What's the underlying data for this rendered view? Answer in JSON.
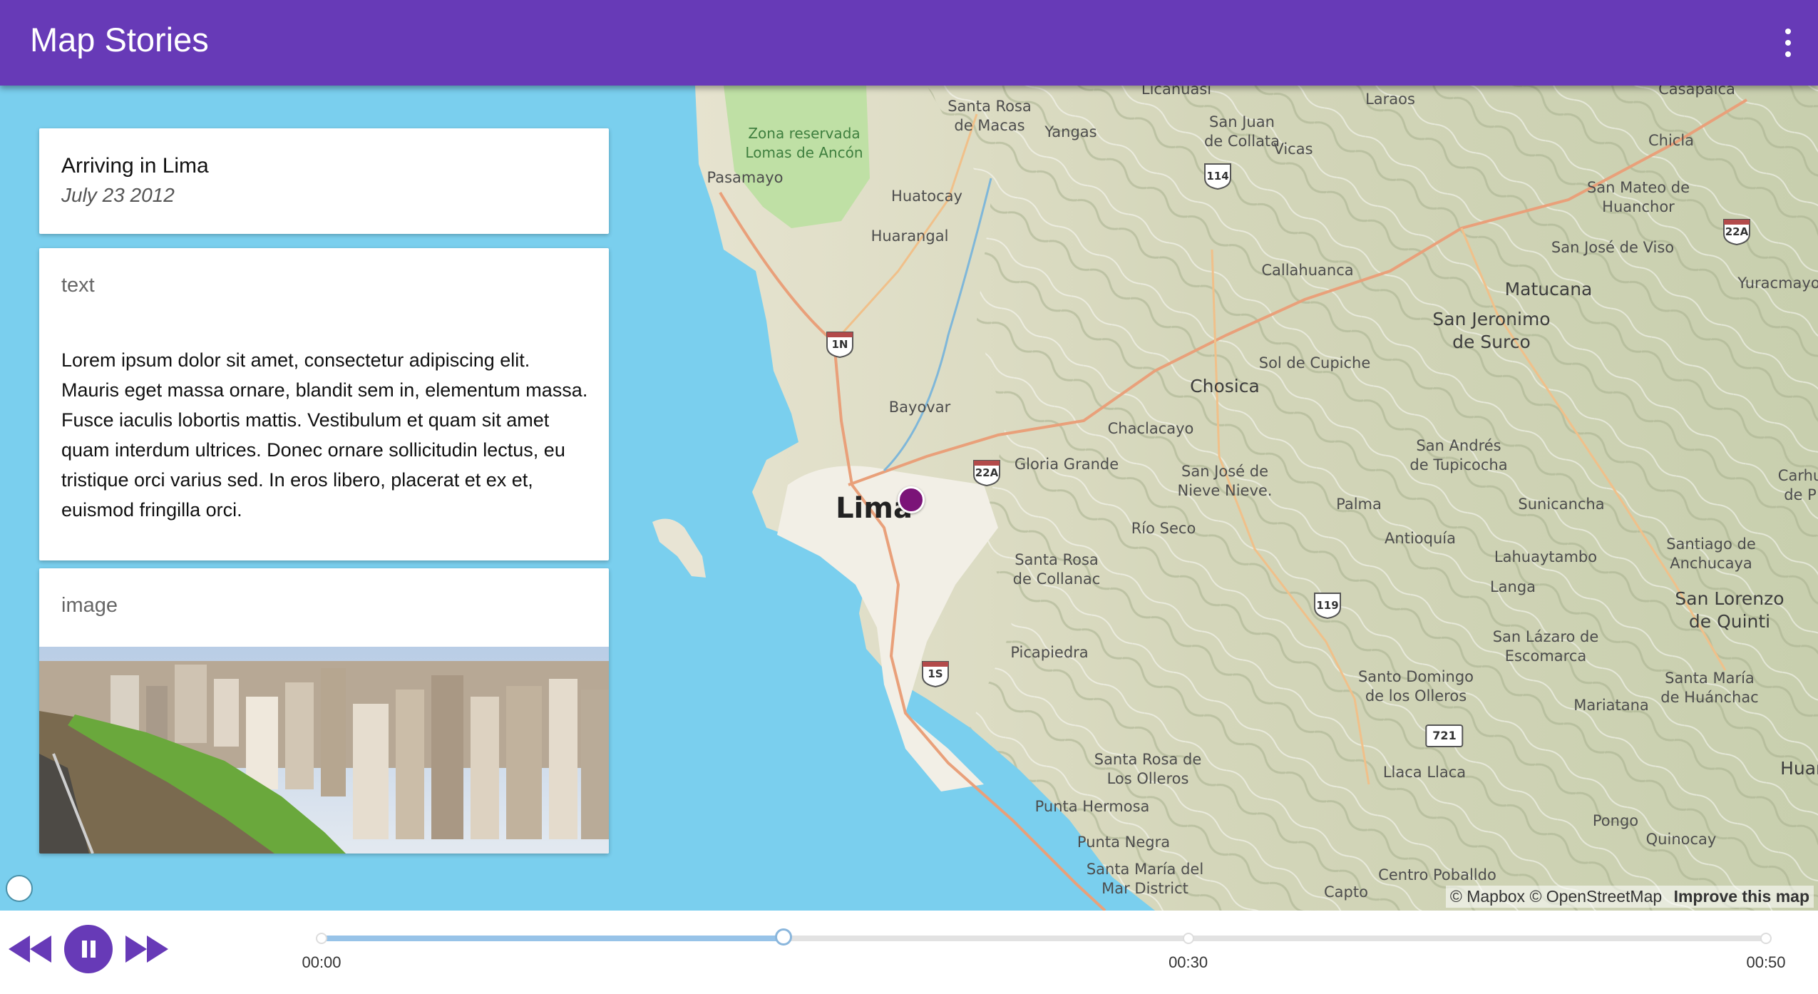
{
  "app": {
    "title": "Map Stories"
  },
  "story": {
    "title": "Arriving in Lima",
    "date": "July 23 2012",
    "text_label": "text",
    "text_body": "Lorem ipsum dolor sit amet, consectetur adipiscing elit. Mauris eget massa ornare, blandit sem in, elementum massa. Fusce iaculis lobortis mattis. Vestibulum et quam sit amet quam interdum ultrices. Donec ornare sollicitudin lectus, eu tristique orci varius sed. In eros libero, placerat et ex et, euismod fringilla orci.",
    "image_label": "image"
  },
  "map": {
    "labels": [
      "Licanuasi",
      "Laraos",
      "Casapalca",
      "Santa Rosa\nde Macas",
      "Yangas",
      "San Juan\nde Collata",
      "Vicas",
      "Chicla",
      "Zona reservada\nLomas de Ancón",
      "Pasamayo",
      "Huatocay",
      "San Mateo de\nHuanchor",
      "Huarangal",
      "San José de Viso",
      "Callahuanca",
      "Yuracmayo",
      "Matucana",
      "San Jeronimo\nde Surco",
      "Sol de Cupiche",
      "Chosica",
      "Bayovar",
      "Chaclacayo",
      "San Andrés\nde Tupicocha",
      "Gloria Grande",
      "San José de\nNieve Nieve.",
      "Palma",
      "Sunicancha",
      "Carhu\nde P",
      "Lima",
      "Río Seco",
      "Antioquía",
      "Santiago de\nAnchucaya",
      "Lahuaytambo",
      "Santa Rosa\nde Collanac",
      "Langa",
      "San Lorenzo\nde Quinti",
      "San Lázaro de\nEscomarca",
      "Picapiedra",
      "Santo Domingo\nde los Olleros",
      "Santa María\nde Huánchac",
      "Mariatana",
      "Santa Rosa de\nLos Olleros",
      "Llaca Llaca",
      "Huañ",
      "Punta Hermosa",
      "Pongo",
      "Quinocay",
      "Punta Negra",
      "Santa María del\nMar District",
      "Centro Poballdo",
      "Capto"
    ],
    "shields": [
      "114",
      "22A",
      "1N",
      "22A",
      "119",
      "1S"
    ],
    "route_box": "721",
    "attribution": {
      "mapbox": "© Mapbox",
      "osm": "© OpenStreetMap",
      "improve": "Improve this map"
    }
  },
  "player": {
    "time_labels": [
      "00:00",
      "00:30",
      "00:50"
    ],
    "total_seconds": 50,
    "current_seconds": 16,
    "stop_seconds": [
      0,
      30,
      50
    ]
  },
  "colors": {
    "accent": "#673ab7",
    "marker": "#7b1478",
    "water": "#7acfee"
  }
}
